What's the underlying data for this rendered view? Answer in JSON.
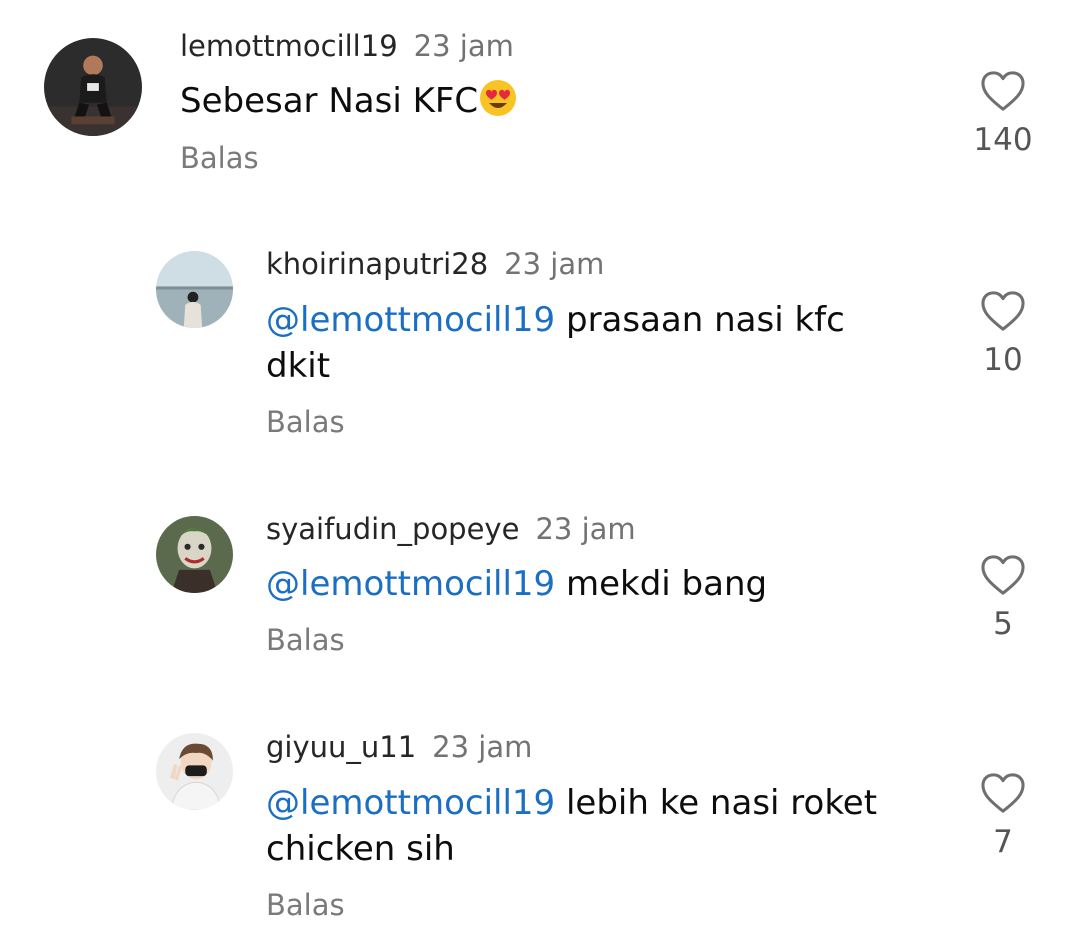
{
  "comments": [
    {
      "username": "lemottmocill19",
      "time": "23 jam",
      "mention": "",
      "text": "Sebesar Nasi KFC",
      "emoji": "heart-eyes-emoji",
      "reply_label": "Balas",
      "likes": "140",
      "avatar_icon": "person-sitting-dark-photo"
    },
    {
      "username": "khoirinaputri28",
      "time": "23 jam",
      "mention": "@lemottmocill19",
      "text": "prasaan nasi kfc dkit",
      "reply_label": "Balas",
      "likes": "10",
      "avatar_icon": "sea-horizon-photo"
    },
    {
      "username": "syaifudin_popeye",
      "time": "23 jam",
      "mention": "@lemottmocill19",
      "text": "mekdi bang",
      "reply_label": "Balas",
      "likes": "5",
      "avatar_icon": "joker-face-photo"
    },
    {
      "username": "giyuu_u11",
      "time": "23 jam",
      "mention": "@lemottmocill19",
      "text": "lebih ke nasi roket chicken sih",
      "reply_label": "Balas",
      "likes": "7",
      "avatar_icon": "person-peace-sign-photo"
    }
  ],
  "colors": {
    "mention": "#1a6fc4",
    "username": "#262626",
    "meta": "#737373",
    "heart_outline": "#6f6f6f"
  }
}
